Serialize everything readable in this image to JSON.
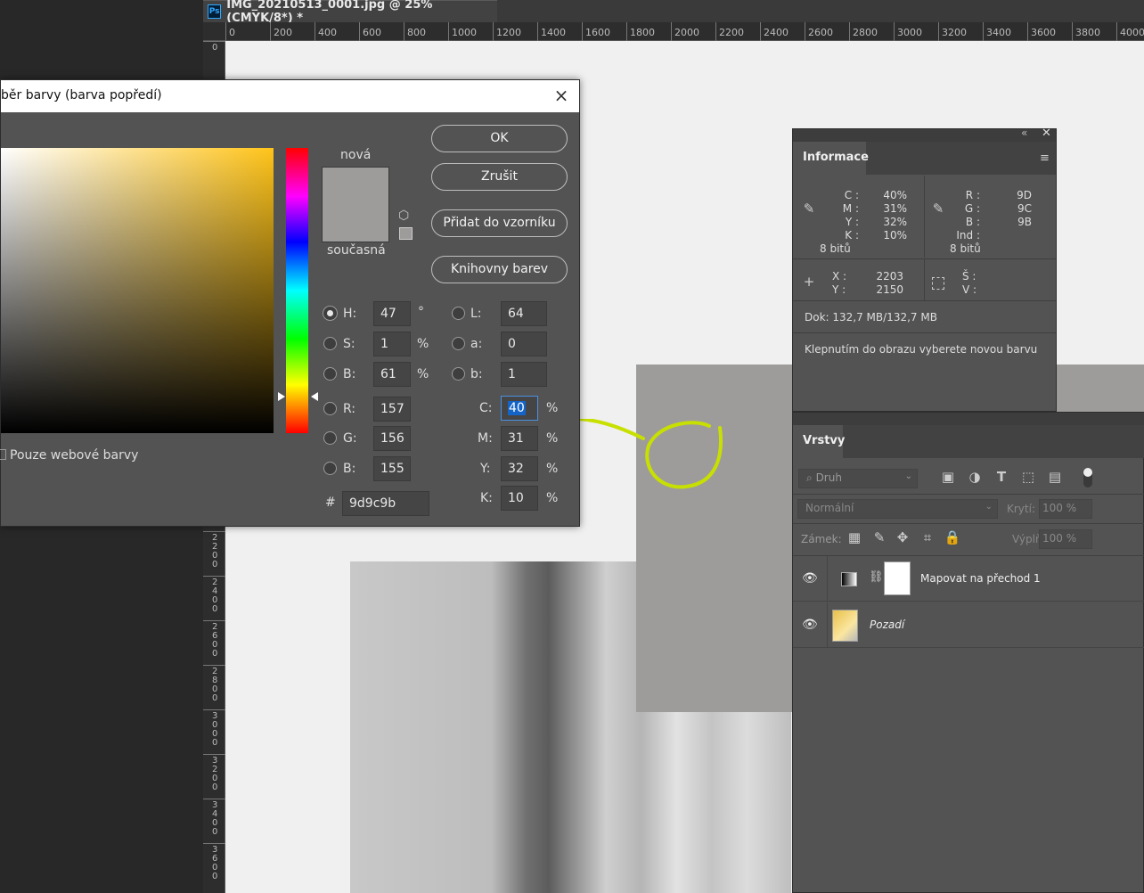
{
  "document": {
    "tab_title": "IMG_20210513_0001.jpg @ 25% (CMYK/8*) *",
    "app_badge": "Ps"
  },
  "rulers": {
    "horizontal": [
      "0",
      "200",
      "400",
      "600",
      "800",
      "1000",
      "1200",
      "1400",
      "1600",
      "1800",
      "2000",
      "2200",
      "2400",
      "2600",
      "2800",
      "3000",
      "3200",
      "3400",
      "3600",
      "3800",
      "4000"
    ],
    "vertical": [
      "0",
      "2\n2\n0\n0",
      "2\n4\n0\n0",
      "2\n6\n0\n0",
      "2\n8\n0\n0",
      "3\n0\n0\n0",
      "3\n2\n0\n0",
      "3\n4\n0\n0",
      "3\n6\n0\n0"
    ]
  },
  "color_picker": {
    "title": "běr barvy (barva popředí)",
    "close_glyph": "×",
    "new_label": "nová",
    "current_label": "současná",
    "swatch_color": "#9d9c9b",
    "buttons": {
      "ok": "OK",
      "cancel": "Zrušit",
      "add_to_swatches": "Přidat do vzorníku",
      "color_libraries": "Knihovny barev"
    },
    "web_only_label": "Pouze webové barvy",
    "hsb": [
      {
        "label": "H:",
        "value": "47",
        "unit": "°",
        "selected": true
      },
      {
        "label": "S:",
        "value": "1",
        "unit": "%",
        "selected": false
      },
      {
        "label": "B:",
        "value": "61",
        "unit": "%",
        "selected": false
      }
    ],
    "rgb": [
      {
        "label": "R:",
        "value": "157"
      },
      {
        "label": "G:",
        "value": "156"
      },
      {
        "label": "B:",
        "value": "155"
      }
    ],
    "lab": [
      {
        "label": "L:",
        "value": "64"
      },
      {
        "label": "a:",
        "value": "0"
      },
      {
        "label": "b:",
        "value": "1"
      }
    ],
    "cmyk": [
      {
        "label": "C:",
        "value": "40",
        "unit": "%"
      },
      {
        "label": "M:",
        "value": "31",
        "unit": "%"
      },
      {
        "label": "Y:",
        "value": "32",
        "unit": "%"
      },
      {
        "label": "K:",
        "value": "10",
        "unit": "%"
      }
    ],
    "hex_label": "#",
    "hex_value": "9d9c9b"
  },
  "info_panel": {
    "tab": "Informace",
    "cmyk_labels": [
      "C :",
      "M :",
      "Y :",
      "K :"
    ],
    "cmyk_values": [
      "40%",
      "31%",
      "32%",
      "10%"
    ],
    "cmyk_depth": "8 bitů",
    "rgb_labels": [
      "R :",
      "G :",
      "B :",
      "Ind :"
    ],
    "rgb_values": [
      "9D",
      "9C",
      "9B",
      ""
    ],
    "rgb_depth": "8 bitů",
    "xy_labels": [
      "X :",
      "Y :"
    ],
    "xy_values": [
      "2203",
      "2150"
    ],
    "wh_labels": [
      "Š :",
      "V :"
    ],
    "doc_size": "Dok: 132,7 MB/132,7 MB",
    "hint": "Klepnutím do obrazu vyberete novou barvu"
  },
  "layers_panel": {
    "tab": "Vrstvy",
    "filter_placeholder": "Druh",
    "blend_mode": "Normální",
    "opacity_label": "Krytí:",
    "opacity_value": "100 %",
    "lock_label": "Zámek:",
    "fill_label": "Výplň:",
    "fill_value": "100 %",
    "layers": [
      {
        "name": "Mapovat na přechod 1"
      },
      {
        "name": "Pozadí"
      }
    ]
  },
  "colors": {
    "sample_gray": "#9d9c9b",
    "annotation": "#c8e000"
  }
}
